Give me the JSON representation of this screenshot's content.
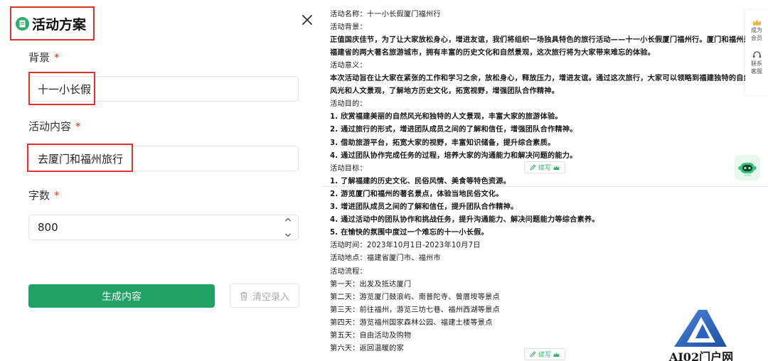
{
  "dialog": {
    "title": "活动方案",
    "fields": [
      {
        "label": "背景",
        "required": "*",
        "value": "十一小长假"
      },
      {
        "label": "活动内容",
        "required": "*",
        "value": "去厦门和福州旅行"
      },
      {
        "label": "字数",
        "required": "*",
        "value": "800"
      }
    ],
    "generate_button": "生成内容",
    "clear_button": "清空录入"
  },
  "output": {
    "lines": [
      {
        "text": "活动名称：十一小长假厦门福州行",
        "bold": false
      },
      {
        "text": "活动背景：",
        "bold": false
      },
      {
        "text": "正值国庆佳节，为了让大家放松身心，增进友谊，我们将组织一场独具特色的旅行活动——十一小长假厦门福州行。厦门和福州是",
        "bold": true
      },
      {
        "text": "福建省的两大著名旅游城市，拥有丰富的历史文化和自然景观，这次旅行将为大家带来难忘的体验。",
        "bold": true
      },
      {
        "text": "活动意义：",
        "bold": false
      },
      {
        "text": "本次活动旨在让大家在紧张的工作和学习之余，放松身心，释放压力，增进友谊。通过这次旅行，大家可以领略到福建独特的自然",
        "bold": true
      },
      {
        "text": "风光和人文景观，了解地方历史文化，拓宽视野，增强团队合作精神。",
        "bold": true
      },
      {
        "text": "活动目的：",
        "bold": false
      },
      {
        "text": "1. 欣赏福建美丽的自然风光和独特的人文景观，丰富大家的旅游体验。",
        "bold": true
      },
      {
        "text": "2. 通过旅行的形式，增进团队成员之间的了解和信任，增强团队合作精神。",
        "bold": true
      },
      {
        "text": "3. 借助旅游平台，拓宽大家的视野，丰富知识储备，提升综合素质。",
        "bold": true
      },
      {
        "text": "4. 通过团队协作完成任务的过程，培养大家的沟通能力和解决问题的能力。",
        "bold": true
      },
      {
        "text": "活动目标：",
        "bold": false
      },
      {
        "text": "1. 了解福建的历史文化、民俗风情、美食等特色资源。",
        "bold": true
      },
      {
        "text": "2. 游览厦门和福州的著名景点，体验当地民俗文化。",
        "bold": true
      },
      {
        "text": "3. 增进团队成员之间的了解和信任，提升团队合作精神。",
        "bold": true
      },
      {
        "text": "4. 通过活动中的团队协作和挑战任务，提升沟通能力、解决问题能力等综合素养。",
        "bold": true
      },
      {
        "text": "5. 在愉快的氛围中度过一个难忘的十一小长假。",
        "bold": true
      },
      {
        "text": "活动时间：2023年10月1日-2023年10月7日",
        "bold": false
      },
      {
        "text": "活动地点：福建省厦门市、福州市",
        "bold": false
      },
      {
        "text": "活动流程：",
        "bold": false
      },
      {
        "text": "第一天：出发及抵达厦门",
        "bold": false
      },
      {
        "text": "第二天：游览厦门鼓浪屿、南普陀寺、曾厝垵等景点",
        "bold": false
      },
      {
        "text": "第三天：前往福州，游览三坊七巷、福州西湖等景点",
        "bold": false
      },
      {
        "text": "第四天：游览福州国家森林公园、福建土楼等景点",
        "bold": false
      },
      {
        "text": "第五天：自由活动及购物",
        "bold": false
      },
      {
        "text": "第六天：返回温暖的家",
        "bold": false
      }
    ],
    "continue_label": "续写"
  },
  "sidebar": {
    "member": "成为会员",
    "member_l1": "成为",
    "member_l2": "会员",
    "service_l1": "联系",
    "service_l2": "客服"
  },
  "watermark": "AI02门户网",
  "colors": {
    "accent_green": "#1fa263",
    "highlight_red": "#e0312c"
  },
  "icons": [
    "document-icon",
    "close-icon",
    "chevron-up-icon",
    "chevron-down-icon",
    "trash-icon",
    "crown-icon",
    "headset-icon",
    "robot-icon",
    "edit-icon"
  ]
}
